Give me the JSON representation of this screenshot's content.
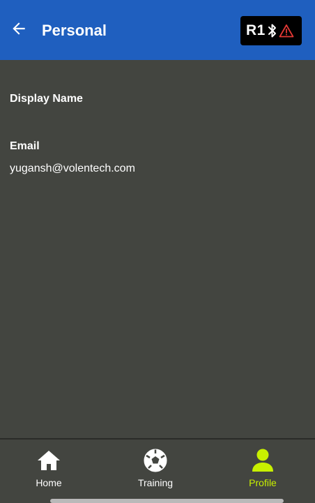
{
  "header": {
    "title": "Personal",
    "device_name": "R1",
    "bluetooth_icon": "bluetooth-icon",
    "warning_icon": "warning-icon",
    "warning_color": "#e53935",
    "background_color": "#1f5fbf"
  },
  "profile": {
    "display_name_label": "Display Name",
    "display_name_value": "",
    "email_label": "Email",
    "email_value": "yugansh@volentech.com"
  },
  "nav": {
    "items": [
      {
        "label": "Home",
        "icon": "home-icon",
        "active": false
      },
      {
        "label": "Training",
        "icon": "soccer-ball-icon",
        "active": false
      },
      {
        "label": "Profile",
        "icon": "person-icon",
        "active": true
      }
    ],
    "active_color": "#c8f000"
  }
}
